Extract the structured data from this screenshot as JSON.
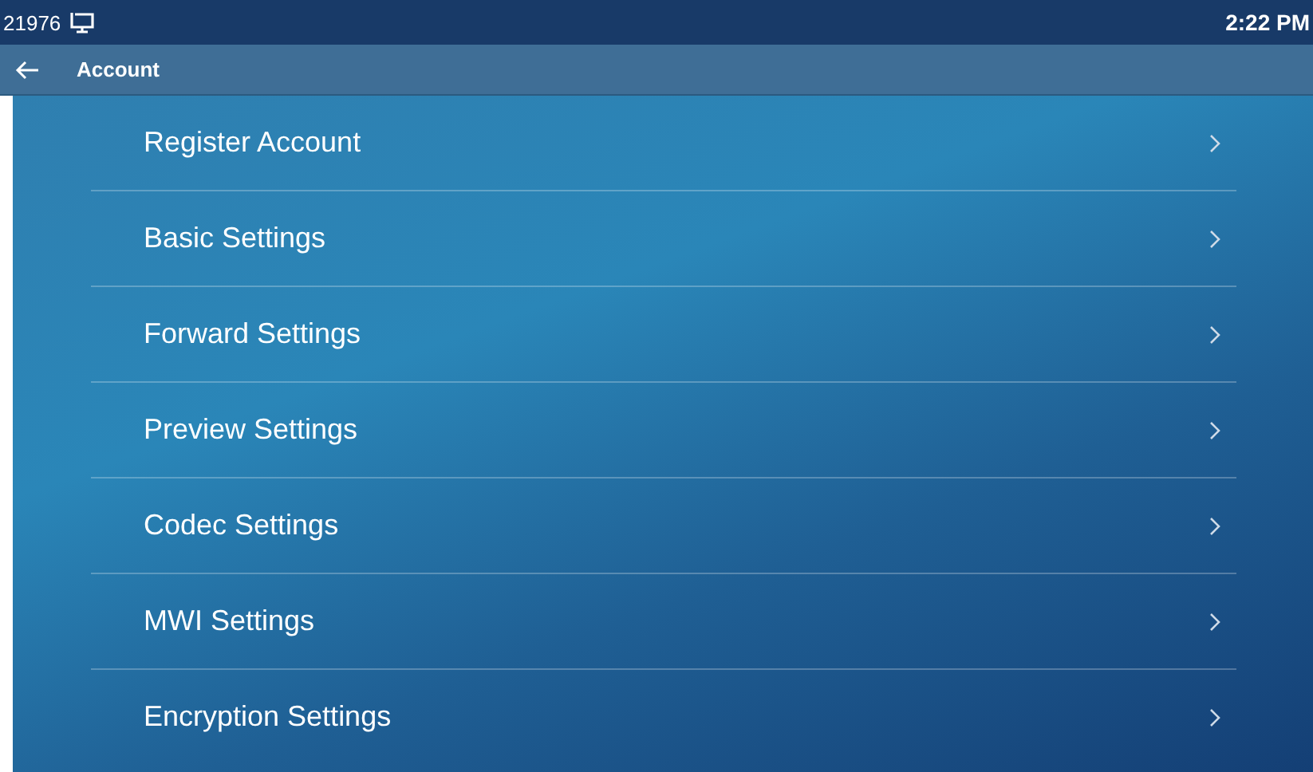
{
  "status_bar": {
    "extension": "21976",
    "time": "2:22 PM"
  },
  "header": {
    "title": "Account"
  },
  "menu_items": [
    {
      "label": "Register Account"
    },
    {
      "label": "Basic Settings"
    },
    {
      "label": "Forward Settings"
    },
    {
      "label": "Preview Settings"
    },
    {
      "label": "Codec Settings"
    },
    {
      "label": "MWI Settings"
    },
    {
      "label": "Encryption Settings"
    }
  ]
}
